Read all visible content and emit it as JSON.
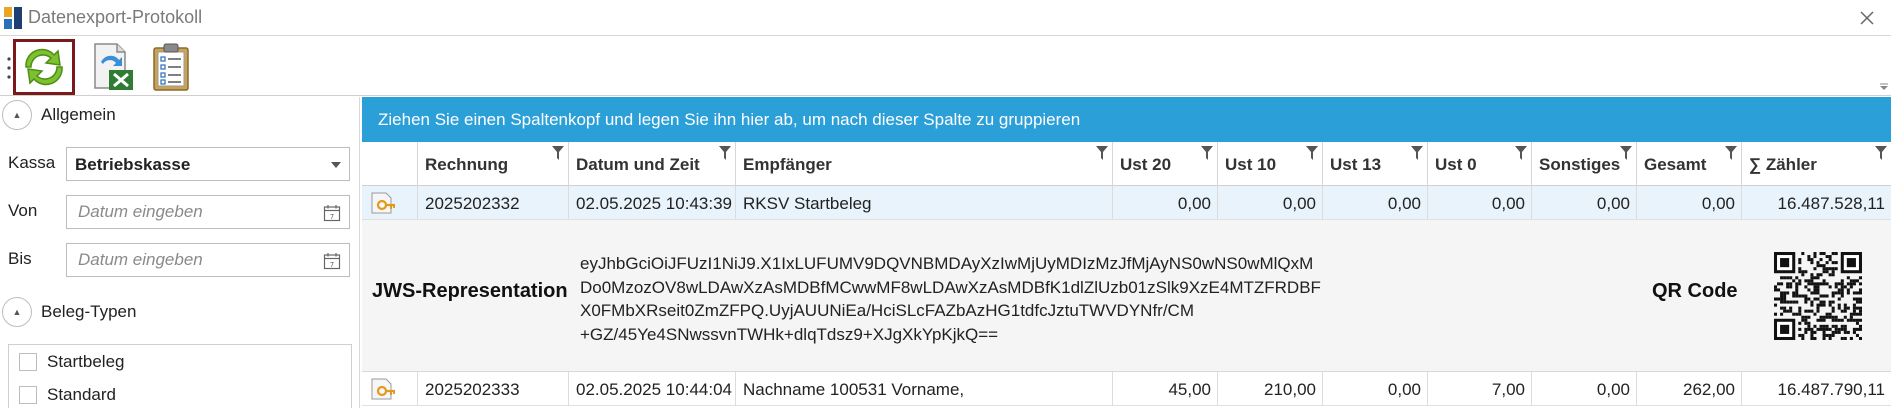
{
  "window": {
    "title": "Datenexport-Protokoll"
  },
  "toolbar": {
    "buttons": [
      {
        "name": "refresh-button",
        "icon": "refresh-icon"
      },
      {
        "name": "excel-export-button",
        "icon": "excel-export-icon"
      },
      {
        "name": "report-button",
        "icon": "clipboard-list-icon"
      }
    ]
  },
  "filters": {
    "general_title": "Allgemein",
    "kassa_label": "Kassa",
    "kassa_value": "Betriebskasse",
    "von_label": "Von",
    "von_placeholder": "Datum eingeben",
    "bis_label": "Bis",
    "bis_placeholder": "Datum eingeben",
    "beleg_title": "Beleg-Typen",
    "beleg_types": [
      "Startbeleg",
      "Standard"
    ]
  },
  "grid": {
    "group_hint": "Ziehen Sie einen Spaltenkopf und legen Sie ihn hier ab, um nach dieser Spalte zu gruppieren",
    "columns": [
      "Rechnung",
      "Datum und Zeit",
      "Empfänger",
      "Ust 20",
      "Ust 10",
      "Ust 13",
      "Ust 0",
      "Sonstiges",
      "Gesamt",
      "∑ Zähler"
    ],
    "rows": [
      {
        "rechnung": "2025202332",
        "datum": "02.05.2025 10:43:39",
        "empfaenger": "RKSV Startbeleg",
        "ust20": "0,00",
        "ust10": "0,00",
        "ust13": "0,00",
        "ust0": "0,00",
        "sonstiges": "0,00",
        "gesamt": "0,00",
        "zaehler": "16.487.528,11"
      },
      {
        "rechnung": "2025202333",
        "datum": "02.05.2025 10:44:04",
        "empfaenger": "Nachname 100531 Vorname,",
        "ust20": "45,00",
        "ust10": "210,00",
        "ust13": "0,00",
        "ust0": "7,00",
        "sonstiges": "0,00",
        "gesamt": "262,00",
        "zaehler": "16.487.790,11"
      }
    ],
    "detail": {
      "jws_label": "JWS-Representation",
      "jws_lines": [
        "eyJhbGciOiJFUzI1NiJ9.X1IxLUFUMV9DQVNBMDAyXzIwMjUyMDIzMzJfMjAyNS0wNS0wMlQxM",
        "Do0MzozOV8wLDAwXzAsMDBfMCwwMF8wLDAwXzAsMDBfK1dlZlUzb01zSlk9XzE4MTZFRDBF",
        "X0FMbXRseit0ZmZFPQ.UyjAUUNiEa/HciSLcFAZbAzHG1tdfcJztuTWVDYNfr/CM",
        "+GZ/45Ye4SNwssvnTWHk+dlqTdsz9+XJgXkYpKjkQ=="
      ],
      "qr_label": "QR Code"
    }
  }
}
